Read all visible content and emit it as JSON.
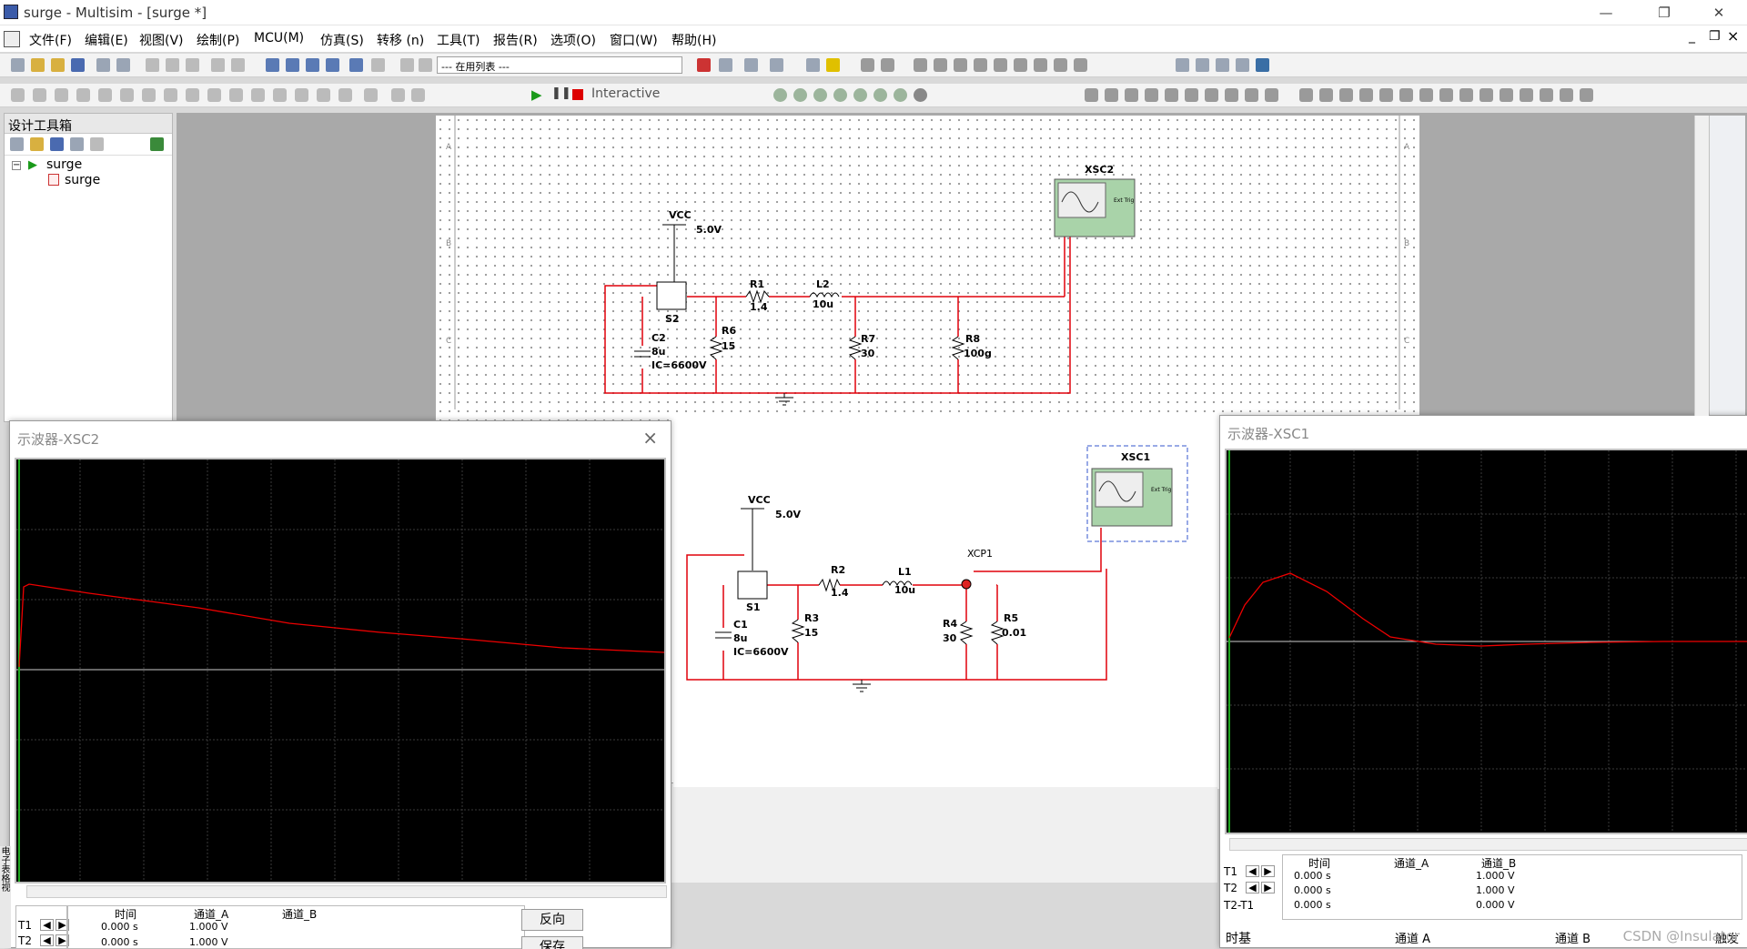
{
  "window": {
    "title": "surge - Multisim - [surge *]",
    "controls": [
      "—",
      "❐",
      "✕"
    ]
  },
  "menu": [
    "文件(F)",
    "编辑(E)",
    "视图(V)",
    "绘制(P)",
    "MCU(M)",
    "仿真(S)",
    "转移 (n)",
    "工具(T)",
    "报告(R)",
    "选项(O)",
    "窗口(W)",
    "帮助(H)"
  ],
  "mdi_controls": [
    "_",
    "❐",
    "×"
  ],
  "toolbar": {
    "in_use_list": "--- 在用列表 ---",
    "sim_mode": "Interactive"
  },
  "toolbox": {
    "title": "设计工具箱",
    "tree": [
      {
        "label": "surge",
        "level": 0
      },
      {
        "label": "surge",
        "level": 1
      }
    ]
  },
  "schematic_top": {
    "vcc": "VCC",
    "vcc_value": "5.0V",
    "switch": "S2",
    "cap": {
      "name": "C2",
      "value": "8u",
      "ic": "IC=6600V"
    },
    "r1": {
      "name": "R1",
      "value": "1.4"
    },
    "l2": {
      "name": "L2",
      "value": "10u"
    },
    "r6": {
      "name": "R6",
      "value": "15"
    },
    "r7": {
      "name": "R7",
      "value": "30"
    },
    "r8": {
      "name": "R8",
      "value": "100g"
    },
    "scope": "XSC2",
    "ext_trig": "Ext Trig"
  },
  "schematic_bottom": {
    "vcc": "VCC",
    "vcc_value": "5.0V",
    "switch": "S1",
    "cap": {
      "name": "C1",
      "value": "8u",
      "ic": "IC=6600V"
    },
    "r2": {
      "name": "R2",
      "value": "1.4"
    },
    "l1": {
      "name": "L1",
      "value": "10u"
    },
    "r3": {
      "name": "R3",
      "value": "15"
    },
    "r4": {
      "name": "R4",
      "value": "30"
    },
    "r5": {
      "name": "R5",
      "value": "0.01"
    },
    "probe": "XCP1",
    "scope": "XSC1",
    "ext_trig": "Ext Trig"
  },
  "border_letters": [
    "A",
    "B",
    "C"
  ],
  "scope_xsc2": {
    "title": "示波器-XSC2",
    "close": "×",
    "headers": [
      "时间",
      "通道_A",
      "通道_B"
    ],
    "rows": [
      {
        "label": "T1",
        "time": "0.000 s",
        "a": "1.000 V",
        "b": ""
      },
      {
        "label": "T2",
        "time": "0.000 s",
        "a": "1.000 V",
        "b": ""
      }
    ],
    "reverse_button": "反向",
    "save_button": "保存"
  },
  "scope_xsc1": {
    "title": "示波器-XSC1",
    "headers": [
      "时间",
      "通道_A",
      "通道_B"
    ],
    "rows": [
      {
        "label": "T1",
        "time": "0.000 s",
        "a": "",
        "b": "1.000 V"
      },
      {
        "label": "T2",
        "time": "0.000 s",
        "a": "",
        "b": "1.000 V"
      },
      {
        "label": "T2-T1",
        "time": "0.000 s",
        "a": "",
        "b": "0.000 V"
      }
    ],
    "timebase": "时基",
    "channel_a": "通道 A",
    "channel_b": "通道 B",
    "trigger": "触发"
  },
  "side_tab": "电子表格视",
  "watermark": "CSDN @Insulator"
}
